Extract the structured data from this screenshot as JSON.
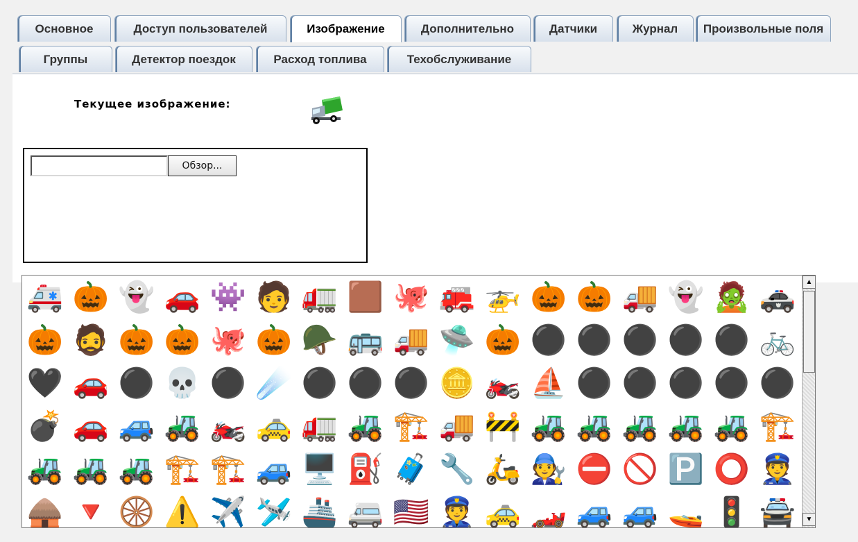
{
  "tabs": {
    "row1": [
      "Основное",
      "Доступ пользователей",
      "Изображение",
      "Дополнительно",
      "Датчики",
      "Журнал",
      "Произвольные поля"
    ],
    "row2": [
      "Группы",
      "Детектор поездок",
      "Расход топлива",
      "Техобслуживание"
    ],
    "active": "Изображение"
  },
  "current_image": {
    "label": "Текущее изображение:",
    "icon": "green-truck-icon"
  },
  "upload": {
    "browse_label": "Обзор..."
  },
  "gallery": {
    "icons": [
      "🚑",
      "🎃",
      "👻",
      "🚗",
      "👾",
      "🧑",
      "🚛",
      "🟫",
      "🐙",
      "🚒",
      "🚁",
      "🎃",
      "🎃",
      "🚚",
      "👻",
      "🧟",
      "🚓",
      "🎃",
      "🧔",
      "🎃",
      "🎃",
      "🐙",
      "🎃",
      "🪖",
      "🚌",
      "🚚",
      "🛸",
      "🎃",
      "⚫",
      "⚫",
      "⚫",
      "⚫",
      "⚫",
      "🚲",
      "🖤",
      "🚗",
      "⚫",
      "💀",
      "⚫",
      "☄️",
      "⚫",
      "⚫",
      "⚫",
      "🪙",
      "🏍️",
      "⛵",
      "⚫",
      "⚫",
      "⚫",
      "⚫",
      "⚫",
      "💣",
      "🚗",
      "🚙",
      "🚜",
      "🏍️",
      "🚕",
      "🚛",
      "🚜",
      "🏗️",
      "🚚",
      "🚧",
      "🚜",
      "🚜",
      "🚜",
      "🚜",
      "🚜",
      "🏗️",
      "🚜",
      "🚜",
      "🚜",
      "🏗️",
      "🏗️",
      "🚙",
      "🖥️",
      "⛽",
      "🧳",
      "🔧",
      "🛵",
      "🧑‍🔧",
      "⛔",
      "🚫",
      "🅿️",
      "⭕",
      "👮",
      "🛖",
      "🔻",
      "🛞",
      "⚠️",
      "✈️",
      "🛩️",
      "🚢",
      "🚐",
      "🇺🇸",
      "👮",
      "🚕",
      "🏎️",
      "🚙",
      "🚙",
      "🚤",
      "🚦",
      "🚔"
    ]
  }
}
